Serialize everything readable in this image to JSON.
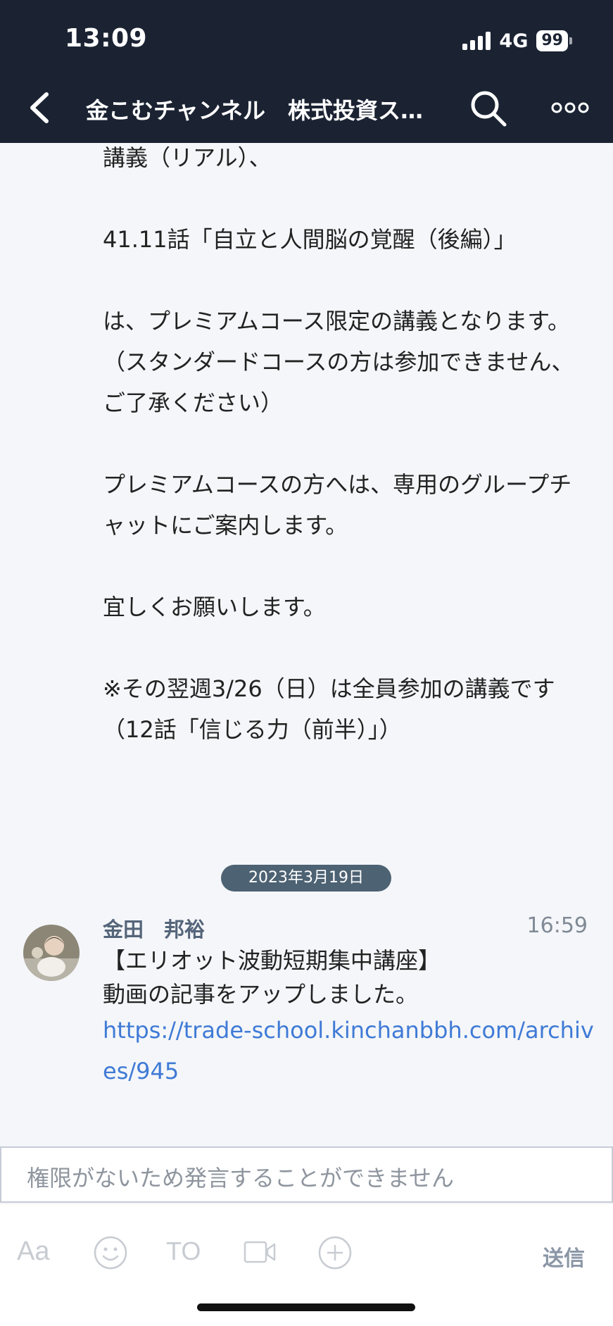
{
  "status_bar": {
    "time": "13:09",
    "network": "4G",
    "battery": "99"
  },
  "header": {
    "title": "金こむチャンネル　株式投資ス…"
  },
  "messages": {
    "prev_body": "講義（リアル）、\n\n41.11話「自立と人間脳の覚醒（後編）」\n\nは、プレミアムコース限定の講義となります。\n（スタンダードコースの方は参加できません、ご了承ください）\n\nプレミアムコースの方へは、専用のグループチャットにご案内します。\n\n宜しくお願いします。\n\n※その翌週3/26（日）は全員参加の講義です\n（12話「信じる力（前半）」）",
    "date_divider": "2023年3月19日",
    "latest": {
      "sender": "金田　邦裕",
      "time": "16:59",
      "line1": "【エリオット波動短期集中講座】",
      "line2": "動画の記事をアップしました。",
      "link": "https://trade-school.kinchanbbh.com/archives/945"
    }
  },
  "composer": {
    "placeholder": "権限がないため発言することができません",
    "aa_label": "Aa",
    "to_label": "TO",
    "send_label": "送信"
  },
  "icons": [
    "back-arrow-icon",
    "search-icon",
    "more-icon",
    "emoji-icon",
    "video-icon",
    "add-icon"
  ],
  "colors": {
    "header_bg": "#1b2333",
    "link": "#3f7ad6",
    "date_badge": "#4d6273"
  }
}
